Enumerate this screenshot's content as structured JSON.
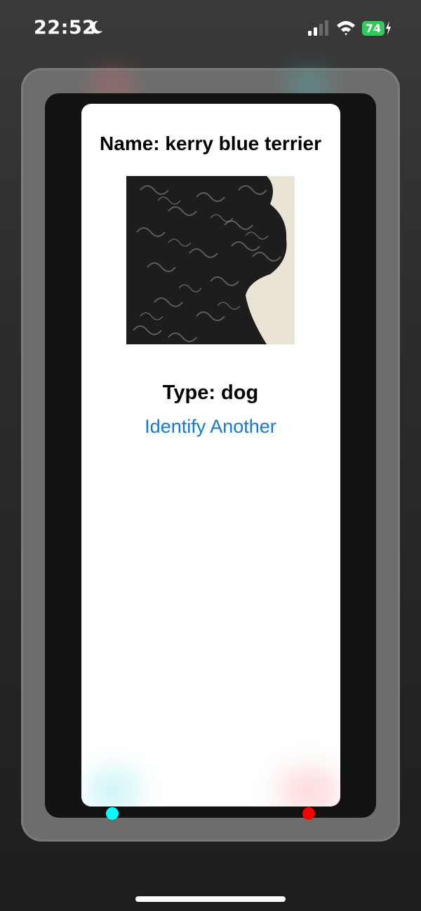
{
  "status_bar": {
    "time": "22:52",
    "battery_percent": "74",
    "icons": [
      "moon-icon",
      "cellular-signal-icon",
      "wifi-icon",
      "battery-charging-icon"
    ]
  },
  "result": {
    "name_text": "Name: kerry blue terrier",
    "type_text": "Type: dog",
    "identify_another_label": "Identify Another"
  },
  "colors": {
    "link": "#1478d4",
    "battery": "#34c759",
    "left_indicator": "#00ffff",
    "right_indicator": "#ff0000"
  }
}
